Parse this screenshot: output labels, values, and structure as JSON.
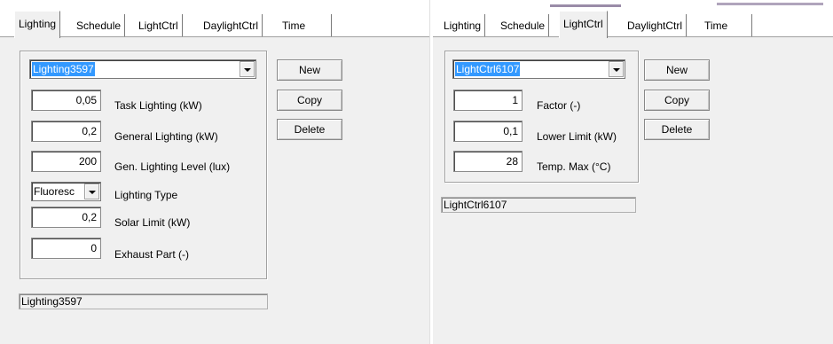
{
  "left_panel": {
    "tabs": [
      "Lighting",
      "Schedule",
      "LightCtrl",
      "DaylightCtrl",
      "Time"
    ],
    "active_tab": "Lighting",
    "object_select": {
      "selected": "Lighting3597"
    },
    "fields": [
      {
        "value": "0,05",
        "label": "Task Lighting (kW)"
      },
      {
        "value": "0,2",
        "label": "General Lighting (kW)"
      },
      {
        "value": "200",
        "label": "Gen. Lighting Level (lux)"
      },
      {
        "value": "0,2",
        "label": "Solar Limit (kW)"
      },
      {
        "value": "0",
        "label": "Exhaust Part (-)"
      }
    ],
    "lighting_type": {
      "value": "Fluoresc",
      "label": "Lighting Type"
    },
    "buttons": {
      "new": "New",
      "copy": "Copy",
      "delete": "Delete"
    },
    "status": "Lighting3597"
  },
  "right_panel": {
    "tabs": [
      "Lighting",
      "Schedule",
      "LightCtrl",
      "DaylightCtrl",
      "Time"
    ],
    "active_tab": "LightCtrl",
    "object_select": {
      "selected": "LightCtrl6107"
    },
    "fields": [
      {
        "value": "1",
        "label": "Factor (-)"
      },
      {
        "value": "0,1",
        "label": "Lower Limit (kW)"
      },
      {
        "value": "28",
        "label": "Temp. Max (°C)"
      }
    ],
    "buttons": {
      "new": "New",
      "copy": "Copy",
      "delete": "Delete"
    },
    "status": "LightCtrl6107"
  },
  "colors": {
    "selection": "#3399ff",
    "background": "#f0f0f0"
  }
}
